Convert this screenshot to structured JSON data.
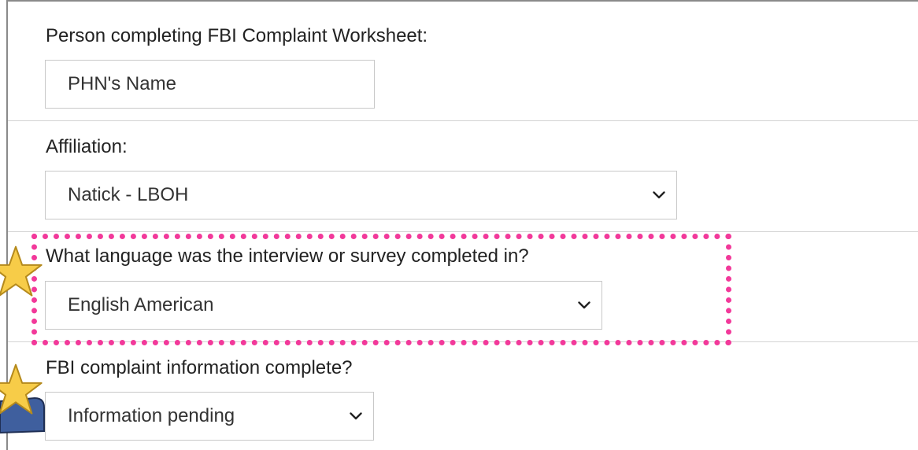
{
  "form": {
    "person": {
      "label": "Person completing FBI Complaint Worksheet:",
      "value": "PHN's Name"
    },
    "affiliation": {
      "label": "Affiliation:",
      "selected": "Natick - LBOH"
    },
    "language": {
      "label": "What language was the interview or survey completed in?",
      "selected": "English American"
    },
    "complete": {
      "label": "FBI complaint information complete?",
      "selected": "Information pending"
    }
  },
  "decorations": {
    "highlight_color": "#f2399a",
    "star_color": "#f7cc48",
    "ribbon_color": "#3f5f9e",
    "icons": [
      "star-icon",
      "chevron-down-icon"
    ]
  }
}
